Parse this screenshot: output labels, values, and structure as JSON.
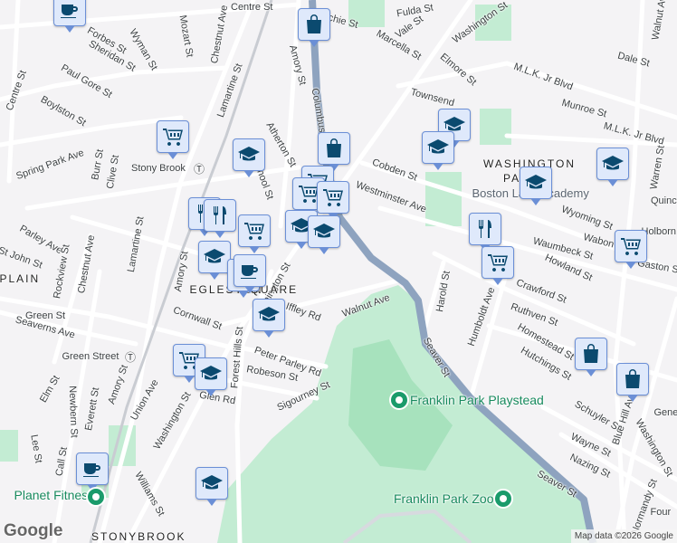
{
  "map": {
    "attribution": "Map data ©2026 Google",
    "logo": "Google",
    "colors": {
      "land": "#f4f3f5",
      "park": "#c3ecd3",
      "park_dark": "#a7e2bd",
      "road": "#ffffff",
      "road_edge": "#d4d8de",
      "arterial": "#8ea3bf",
      "marker_bg": "#dfe9fb",
      "marker_icon": "#0b4a6f",
      "poi": "#188a5e"
    },
    "labels": [
      "Centre St",
      "Fulda St",
      "Vale St",
      "Marcella St",
      "Ritchie St",
      "Forbes St",
      "Wyman St",
      "Mozart St",
      "Chestnut Ave",
      "Lamartine St",
      "Sheridan St",
      "Paul Gore St",
      "Amory St",
      "Columbus",
      "Boylston St",
      "Washington St",
      "M.L.K. Jr Blvd",
      "Dale St",
      "Walnut Av",
      "Elmore St",
      "Townsend",
      "Munroe St",
      "M.L.K. Jr Blvd",
      "Centre St",
      "Spring Park Ave",
      "Burr St",
      "Clive St",
      "Stony Brook",
      "Atherton St",
      "School St",
      "Cobden St",
      "Westminster Ave",
      "Warren St",
      "Quincy",
      "Wyoming St",
      "Holborn",
      "Waumbeck St",
      "Wabon St",
      "Gaston St",
      "Howland St",
      "Crawford St",
      "Ruthven St",
      "Homestead St",
      "Hutchings St",
      "Harold St",
      "Humboldt Ave",
      "Seaver St",
      "Walnut Ave",
      "Parley Ave",
      "Rockview St",
      "Chestnut Ave",
      "St John St",
      "Lamartine St",
      "Amory St",
      "Green St",
      "Seaverns Ave",
      "Cornwall St",
      "Forest Hills St",
      "Iffley Rd",
      "Peter Parley Rd",
      "Robeson St",
      "Sigourney St",
      "Washington St",
      "Green Street",
      "Amory St",
      "Elm St",
      "Newbern St",
      "Everett St",
      "Union Ave",
      "Washington St",
      "Glen Rd",
      "Lee St",
      "Call St",
      "Williams St",
      "Schuyler St",
      "Wayne St",
      "Nazing St",
      "Seaver St",
      "Blue Hill Ave",
      "Washington St",
      "Normandy St",
      "Four",
      "Gene"
    ],
    "areas": [
      "WASHINGTON",
      "PARK",
      "EGLESTON",
      "SQUARE",
      "PLAIN",
      "STONYBROOK"
    ],
    "pois": [
      "Boston Latin Academy",
      "Franklin Park Playstead",
      "Franklin Park Zoo",
      "Planet Fitness"
    ],
    "transit": [
      "Stony Brook",
      "Green Street"
    ],
    "markers": [
      "coffee-icon",
      "shopping-bag-icon",
      "cart-icon",
      "school-icon",
      "shopping-bag-icon",
      "cart-icon",
      "cart-icon",
      "cart-icon",
      "school-icon",
      "school-icon",
      "school-icon",
      "school-icon",
      "restaurant-icon",
      "restaurant-icon",
      "restaurant-icon",
      "cart-icon",
      "school-icon",
      "school-icon",
      "school-icon",
      "cart-icon",
      "cart-icon",
      "coffee-icon",
      "coffee-icon",
      "school-icon",
      "cart-icon",
      "school-icon",
      "shopping-bag-icon",
      "shopping-bag-icon",
      "coffee-icon",
      "school-icon"
    ]
  }
}
